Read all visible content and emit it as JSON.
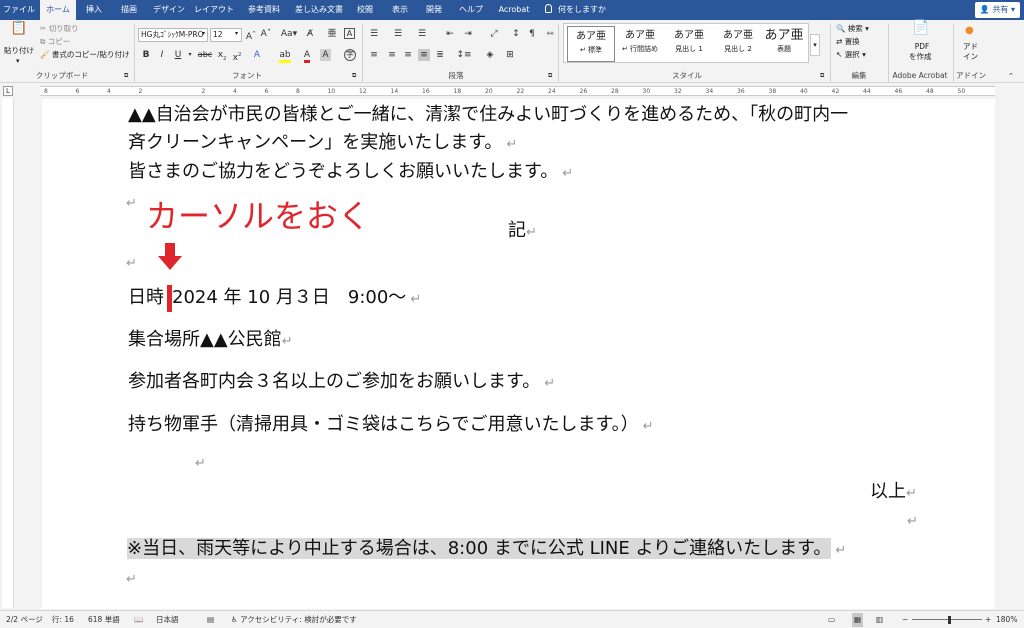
{
  "tabs": [
    {
      "label": "ファイル",
      "active": false
    },
    {
      "label": "ホーム",
      "active": true
    },
    {
      "label": "挿入",
      "active": false
    },
    {
      "label": "描画",
      "active": false
    },
    {
      "label": "デザイン",
      "active": false
    },
    {
      "label": "レイアウト",
      "active": false
    },
    {
      "label": "参考資料",
      "active": false
    },
    {
      "label": "差し込み文書",
      "active": false
    },
    {
      "label": "校閲",
      "active": false
    },
    {
      "label": "表示",
      "active": false
    },
    {
      "label": "開発",
      "active": false
    },
    {
      "label": "ヘルプ",
      "active": false
    },
    {
      "label": "Acrobat",
      "active": false
    }
  ],
  "tell_me": "何をしますか",
  "share_label": "共有",
  "clipboard": {
    "paste": "貼り付け",
    "cut": "切り取り",
    "copy": "コピー",
    "format_painter": "書式のコピー/貼り付け",
    "group": "クリップボード"
  },
  "font": {
    "name": "HG丸ｺﾞｼｯｸM-PRO",
    "size": "12",
    "group": "フォント"
  },
  "paragraph_group": "段落",
  "styles": {
    "items": [
      {
        "preview": "あア亜",
        "name": "標準",
        "selected": true
      },
      {
        "preview": "あア亜",
        "name": "行間詰め",
        "selected": false
      },
      {
        "preview": "あア亜",
        "name": "見出し 1",
        "selected": false
      },
      {
        "preview": "あア亜",
        "name": "見出し 2",
        "selected": false
      },
      {
        "preview": "あア亜",
        "name": "表題",
        "selected": false
      }
    ],
    "group": "スタイル"
  },
  "editing": {
    "find": "検索",
    "replace": "置換",
    "select": "選択",
    "group": "編集"
  },
  "acrobat": {
    "pdf_line1": "PDF",
    "pdf_line2": "を作成",
    "group": "Adobe Acrobat"
  },
  "addins": {
    "line1": "アド",
    "line2": "イン",
    "group": "アドイン"
  },
  "document": {
    "line1": "▲▲自治会が市民の皆様とご一緒に、清潔で住みよい町づくりを進めるため、「秋の町内一",
    "line2": "斉クリーンキャンペーン」を実施いたします。",
    "line3": "皆さまのご協力をどうぞよろしくお願いいたします。",
    "ki": "記",
    "datetime_label": "日時",
    "datetime_value": "2024 年 10 月３日　9:00～",
    "place": "集合場所▲▲公民館",
    "participants": "参加者各町内会３名以上のご参加をお願いします。",
    "items": "持ち物軍手（清掃用具・ゴミ袋はこちらでご用意いたします。）",
    "ijou": "以上",
    "note": "※当日、雨天等により中止する場合は、8:00 までに公式 LINE よりご連絡いたします。",
    "paragraph_mark": "↵"
  },
  "annotation": {
    "text": "カーソルをおく",
    "color": "#e0262d"
  },
  "status": {
    "page": "2/2 ページ",
    "line": "行: 16",
    "words": "618 単語",
    "language": "日本語",
    "accessibility": "アクセシビリティ: 検討が必要です",
    "zoom": "180%"
  },
  "ruler_numbers": [
    "8",
    "6",
    "4",
    "2",
    "",
    "2",
    "4",
    "6",
    "8",
    "10",
    "12",
    "14",
    "16",
    "18",
    "20",
    "22",
    "24",
    "26",
    "28",
    "30",
    "32",
    "34",
    "36",
    "38",
    "40",
    "42",
    "44",
    "46",
    "48",
    "50"
  ],
  "colors": {
    "brand": "#2b579a",
    "annotation_red": "#e0262d",
    "highlight": "#d9d9d9"
  }
}
